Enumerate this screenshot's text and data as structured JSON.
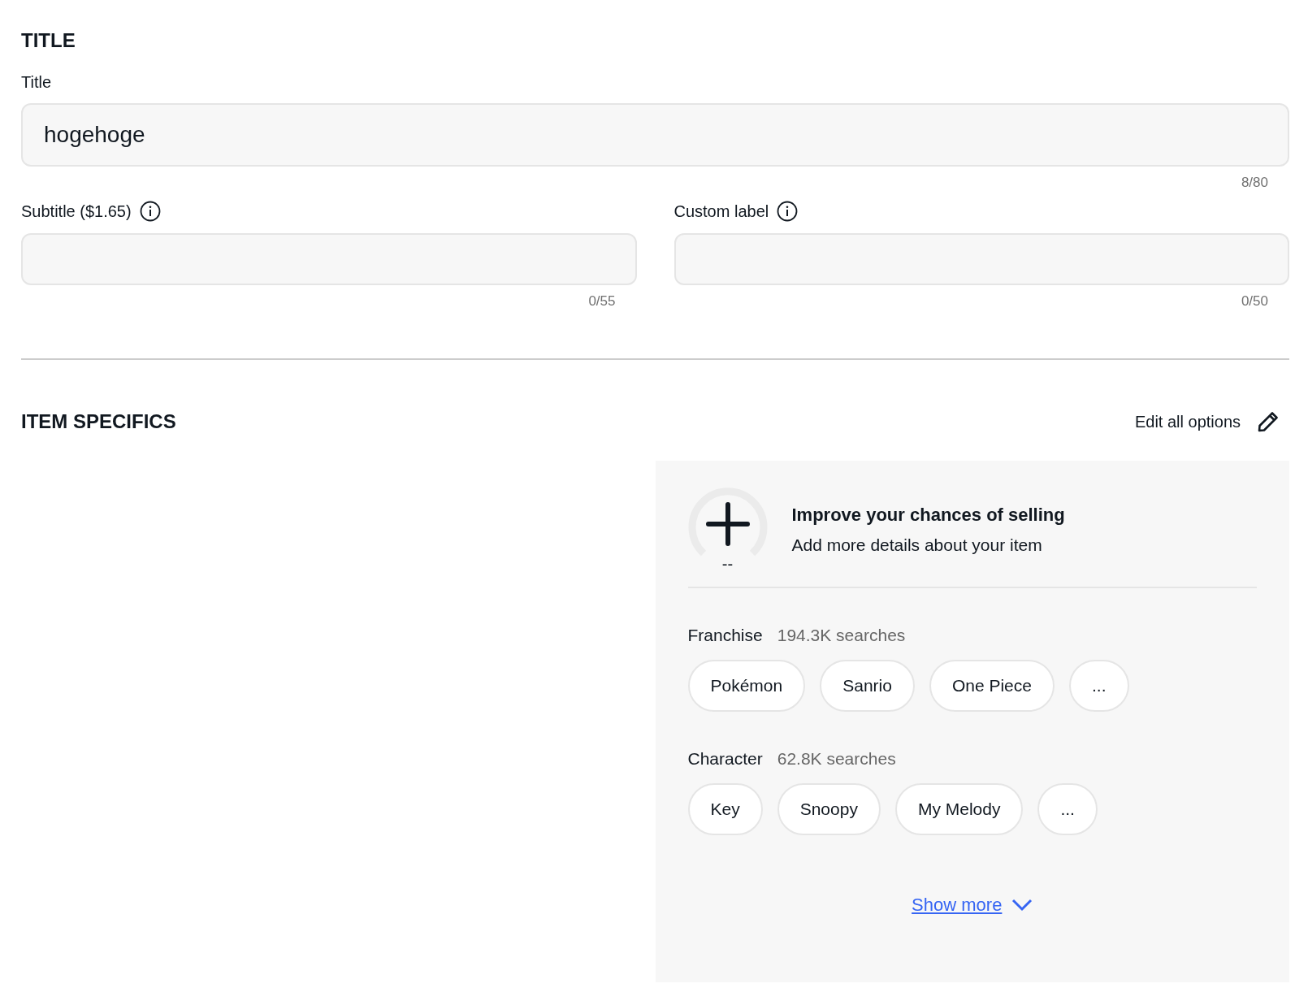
{
  "title_section": {
    "heading": "TITLE",
    "title_field": {
      "label": "Title",
      "value": "hogehoge",
      "counter": "8/80"
    },
    "fields": [
      {
        "label": "Subtitle ($1.65)",
        "info": true,
        "counter": "0/55"
      },
      {
        "label": "Custom label",
        "info": true,
        "counter": "0/50"
      }
    ]
  },
  "item_specifics": {
    "heading": "ITEM SPECIFICS",
    "edit_link": "Edit all options",
    "panel": {
      "score": "--",
      "title": "Improve your chances of selling",
      "subtitle": "Add more details about your item",
      "groups": [
        {
          "name": "Franchise",
          "searches": "194.3K searches",
          "options": [
            "Pokémon",
            "Sanrio",
            "One Piece",
            "..."
          ]
        },
        {
          "name": "Character",
          "searches": "62.8K searches",
          "options": [
            "Key",
            "Snoopy",
            "My Melody",
            "..."
          ]
        }
      ],
      "show_more": "Show more"
    }
  }
}
